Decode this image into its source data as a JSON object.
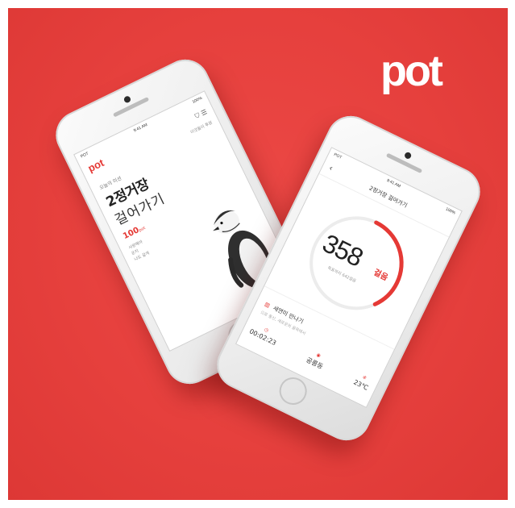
{
  "brand": {
    "logo_text": "pot",
    "accent": "#e53935",
    "background": "#e6403d"
  },
  "left_phone": {
    "status_time": "9:41 AM",
    "status_carrier": "POT",
    "status_battery": "100%",
    "app_logo": "pot",
    "sponsor": "이것들이 후원",
    "mission_label": "오늘의 미션",
    "mission_title": "2정거장",
    "mission_subtitle": "걸어가기",
    "points": "100",
    "points_unit": "pot",
    "desc": [
      "사랑해야",
      "운지",
      "나도 같게"
    ]
  },
  "right_phone": {
    "status_time": "9:41 AM",
    "status_carrier": "POT",
    "status_battery": "100%",
    "title": "2정거장 걸어가기",
    "steps": "358",
    "steps_unit": "걸음",
    "steps_goal": "목표까지 642걸음",
    "progress": 0.36,
    "recent_label": "새연미 만나기",
    "recent_sub": "으로 통신, 새로운의 골목에서",
    "stats": [
      {
        "icon": "timer-icon",
        "value": "00:02:23"
      },
      {
        "icon": "location-pin-icon",
        "value": "공릉동"
      },
      {
        "icon": "thermometer-icon",
        "value": "23℃"
      }
    ]
  }
}
